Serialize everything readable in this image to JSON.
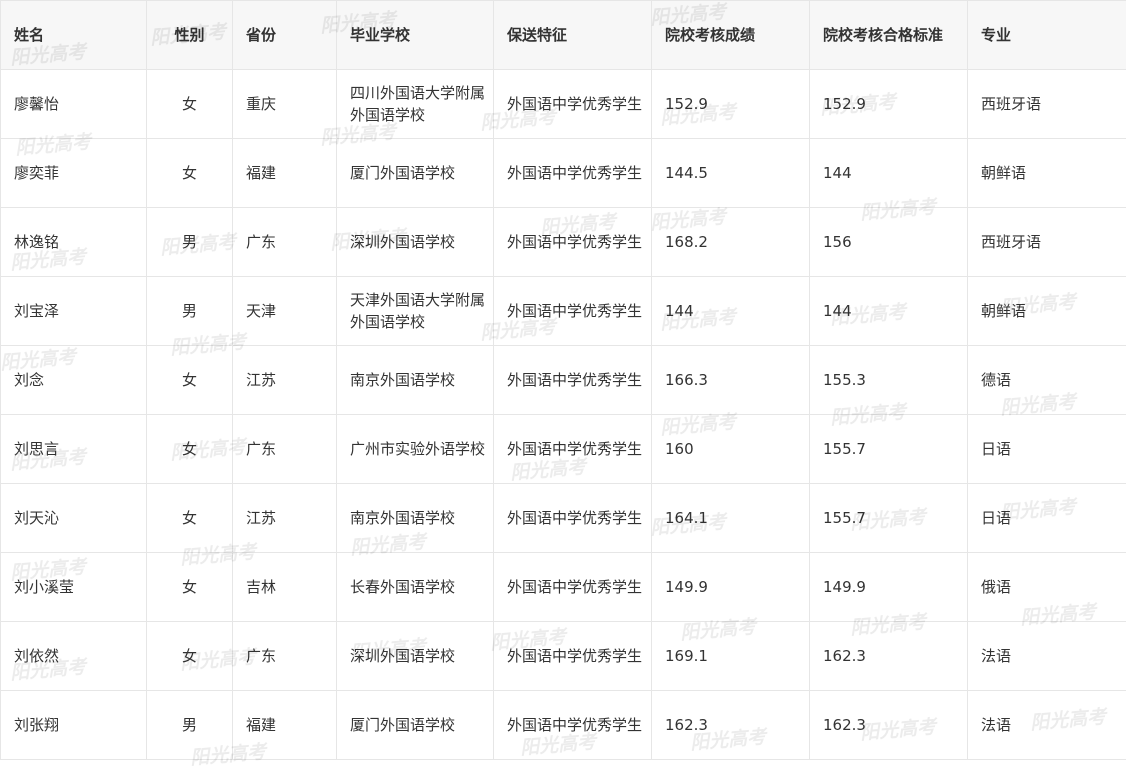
{
  "table": {
    "headers": [
      "姓名",
      "性别",
      "省份",
      "毕业学校",
      "保送特征",
      "院校考核成绩",
      "院校考核合格标准",
      "专业"
    ],
    "rows": [
      [
        "廖馨怡",
        "女",
        "重庆",
        "四川外国语大学附属外国语学校",
        "外国语中学优秀学生",
        "152.9",
        "152.9",
        "西班牙语"
      ],
      [
        "廖奕菲",
        "女",
        "福建",
        "厦门外国语学校",
        "外国语中学优秀学生",
        "144.5",
        "144",
        "朝鲜语"
      ],
      [
        "林逸铭",
        "男",
        "广东",
        "深圳外国语学校",
        "外国语中学优秀学生",
        "168.2",
        "156",
        "西班牙语"
      ],
      [
        "刘宝泽",
        "男",
        "天津",
        "天津外国语大学附属外国语学校",
        "外国语中学优秀学生",
        "144",
        "144",
        "朝鲜语"
      ],
      [
        "刘念",
        "女",
        "江苏",
        "南京外国语学校",
        "外国语中学优秀学生",
        "166.3",
        "155.3",
        "德语"
      ],
      [
        "刘思言",
        "女",
        "广东",
        "广州市实验外语学校",
        "外国语中学优秀学生",
        "160",
        "155.7",
        "日语"
      ],
      [
        "刘天沁",
        "女",
        "江苏",
        "南京外国语学校",
        "外国语中学优秀学生",
        "164.1",
        "155.7",
        "日语"
      ],
      [
        "刘小溪莹",
        "女",
        "吉林",
        "长春外国语学校",
        "外国语中学优秀学生",
        "149.9",
        "149.9",
        "俄语"
      ],
      [
        "刘依然",
        "女",
        "广东",
        "深圳外国语学校",
        "外国语中学优秀学生",
        "169.1",
        "162.3",
        "法语"
      ],
      [
        "刘张翔",
        "男",
        "福建",
        "厦门外国语学校",
        "外国语中学优秀学生",
        "162.3",
        "162.3",
        "法语"
      ]
    ]
  },
  "watermark": {
    "text": "阳光高考"
  }
}
